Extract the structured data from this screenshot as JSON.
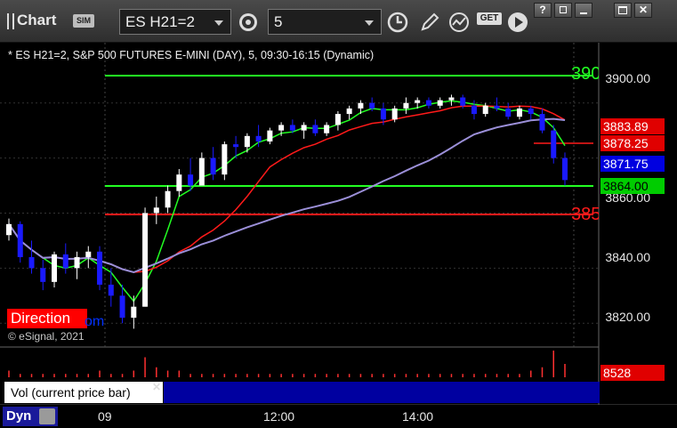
{
  "app": {
    "title": "Chart",
    "badge": "SIM"
  },
  "toolbar": {
    "symbol": "ES H21=2",
    "interval": "5",
    "icons": [
      "settings-gear-icon",
      "clock-icon",
      "draw-pencil-icon",
      "study-curve-icon",
      "get-icon",
      "play-icon"
    ],
    "get_label": "GET"
  },
  "window_controls": [
    "help",
    "restore",
    "minimize",
    "maximize",
    "close"
  ],
  "chart": {
    "title": "* ES H21=2, S&P 500 FUTURES E-MINI (DAY), 5, 09:30-16:15 (Dynamic)",
    "copyright": "© eSignal, 2021",
    "direction_label": "Direction",
    "direction_overlay": "om",
    "y_ticks": [
      "3900.00",
      "3860.00",
      "3840.00",
      "3820.00"
    ],
    "tags": {
      "red_high": "3883.89",
      "red_low": "3878.25",
      "last": "3871.75",
      "green": "3864.00"
    },
    "level_labels": {
      "upper": "390",
      "lower": "385"
    },
    "colors": {
      "up_candle": "#ffffff",
      "down_candle": "#1a1aff",
      "red_line": "#ff1a1a",
      "green_line": "#22ff22",
      "purple_line": "#9b8fd8",
      "tag_red": "#e00000",
      "tag_blue": "#0000e0",
      "tag_green": "#00cc00"
    }
  },
  "volume": {
    "caption": "Vol (current price bar)",
    "value": "8528"
  },
  "time_axis": {
    "button": "Dyn",
    "ticks": [
      "09",
      "12:00",
      "14:00"
    ]
  },
  "chart_data": {
    "type": "candlestick",
    "series": [
      {
        "name": "price",
        "candles": [
          [
            3852,
            3858,
            3850,
            3856
          ],
          [
            3856,
            3857,
            3842,
            3844
          ],
          [
            3844,
            3850,
            3838,
            3840
          ],
          [
            3840,
            3843,
            3832,
            3835
          ],
          [
            3835,
            3846,
            3833,
            3845
          ],
          [
            3845,
            3849,
            3838,
            3840
          ],
          [
            3840,
            3846,
            3836,
            3844
          ],
          [
            3844,
            3848,
            3840,
            3846
          ],
          [
            3846,
            3848,
            3832,
            3834
          ],
          [
            3834,
            3840,
            3826,
            3830
          ],
          [
            3830,
            3834,
            3820,
            3822
          ],
          [
            3822,
            3830,
            3818,
            3826
          ],
          [
            3826,
            3862,
            3826,
            3860
          ],
          [
            3860,
            3866,
            3856,
            3862
          ],
          [
            3862,
            3870,
            3860,
            3868
          ],
          [
            3868,
            3876,
            3866,
            3874
          ],
          [
            3874,
            3880,
            3868,
            3870
          ],
          [
            3870,
            3882,
            3870,
            3880
          ],
          [
            3880,
            3884,
            3872,
            3874
          ],
          [
            3874,
            3886,
            3872,
            3885
          ],
          [
            3885,
            3888,
            3880,
            3884
          ],
          [
            3884,
            3889,
            3882,
            3888
          ],
          [
            3888,
            3892,
            3884,
            3886
          ],
          [
            3886,
            3891,
            3885,
            3890
          ],
          [
            3890,
            3893,
            3888,
            3892
          ],
          [
            3892,
            3894,
            3889,
            3890
          ],
          [
            3890,
            3893,
            3887,
            3892
          ],
          [
            3892,
            3894,
            3888,
            3889
          ],
          [
            3889,
            3893,
            3888,
            3892
          ],
          [
            3892,
            3897,
            3890,
            3896
          ],
          [
            3896,
            3899,
            3894,
            3898
          ],
          [
            3898,
            3901,
            3896,
            3900
          ],
          [
            3900,
            3902,
            3897,
            3898
          ],
          [
            3898,
            3900,
            3892,
            3894
          ],
          [
            3894,
            3899,
            3893,
            3898
          ],
          [
            3898,
            3902,
            3896,
            3900
          ],
          [
            3900,
            3902,
            3898,
            3901
          ],
          [
            3901,
            3902,
            3898,
            3899
          ],
          [
            3899,
            3902,
            3898,
            3901
          ],
          [
            3901,
            3903,
            3899,
            3902
          ],
          [
            3902,
            3903,
            3898,
            3899
          ],
          [
            3899,
            3901,
            3894,
            3896
          ],
          [
            3896,
            3900,
            3895,
            3899
          ],
          [
            3899,
            3902,
            3897,
            3898
          ],
          [
            3898,
            3900,
            3894,
            3895
          ],
          [
            3895,
            3899,
            3894,
            3898
          ],
          [
            3898,
            3899,
            3894,
            3896
          ],
          [
            3896,
            3898,
            3889,
            3890
          ],
          [
            3890,
            3892,
            3878,
            3880
          ],
          [
            3880,
            3882,
            3870,
            3872
          ]
        ]
      },
      {
        "name": "volume",
        "values": [
          2,
          1,
          1,
          1,
          1,
          1,
          1,
          1,
          2,
          1,
          1,
          2,
          6,
          3,
          2,
          2,
          1,
          1,
          1,
          1,
          1,
          1,
          1,
          1,
          1,
          1,
          1,
          1,
          1,
          1,
          1,
          1,
          1,
          1,
          1,
          1,
          1,
          1,
          1,
          1,
          1,
          1,
          1,
          1,
          1,
          1,
          2,
          3,
          8,
          4
        ]
      }
    ],
    "ylim": [
      3812,
      3918
    ]
  }
}
